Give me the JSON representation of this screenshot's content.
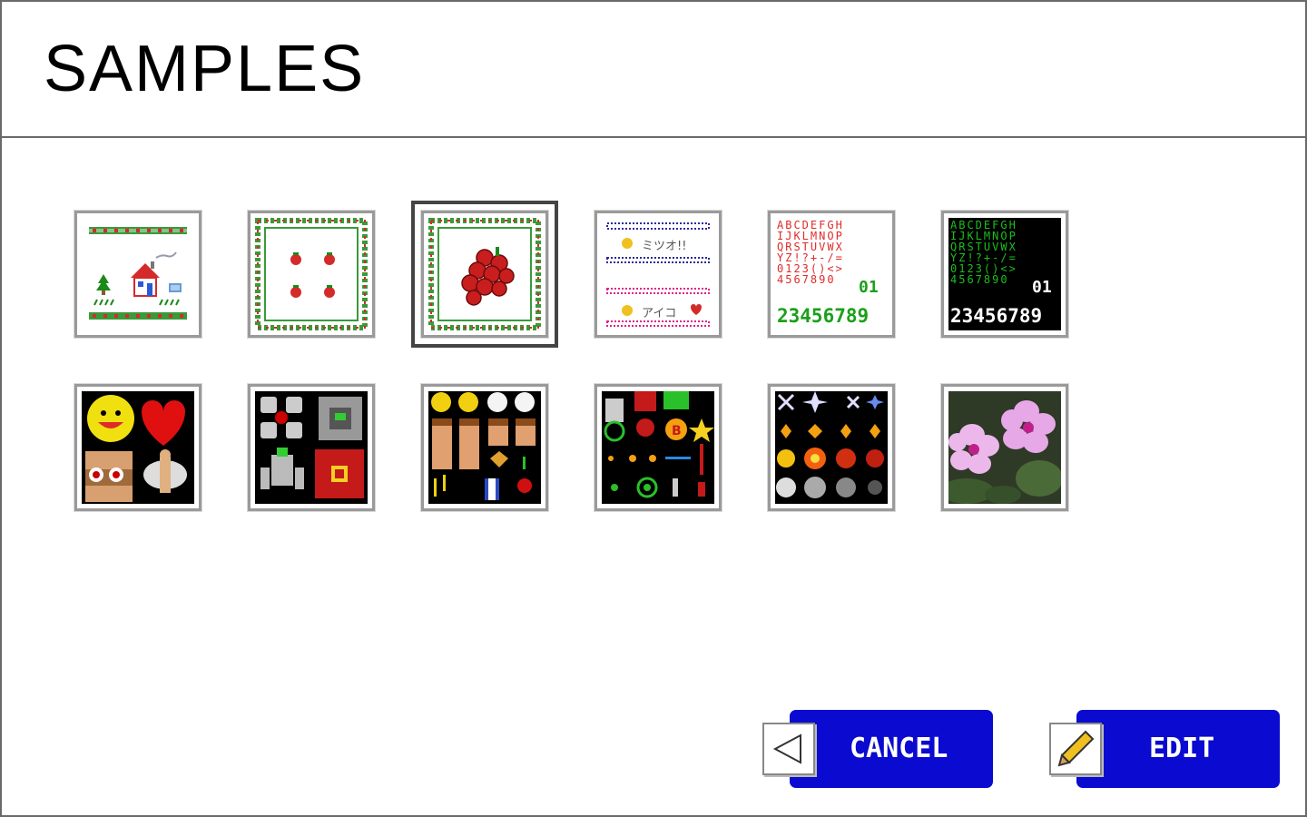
{
  "header": {
    "title": "SAMPLES"
  },
  "samples": [
    {
      "name": "house"
    },
    {
      "name": "strawberries"
    },
    {
      "name": "grapes",
      "selected": true
    },
    {
      "name": "japanese-text"
    },
    {
      "name": "font-red-green",
      "text_row": "23456789",
      "text_small": "01"
    },
    {
      "name": "font-green-black",
      "text_row": "23456789",
      "text_small": "01"
    },
    {
      "name": "smiley-heart-sprites"
    },
    {
      "name": "robot-sprites"
    },
    {
      "name": "faces-sprites"
    },
    {
      "name": "shooter-sprites"
    },
    {
      "name": "explosion-sprites"
    },
    {
      "name": "flower-photo"
    }
  ],
  "font_tile_text": {
    "jp_line1": "ミツオ!!",
    "jp_line2": "アイコ"
  },
  "buttons": {
    "cancel": {
      "label": "CANCEL"
    },
    "edit": {
      "label": "EDIT"
    }
  },
  "colors": {
    "button_blue": "#0a0ad0",
    "border_gray": "#6a6a6a"
  }
}
